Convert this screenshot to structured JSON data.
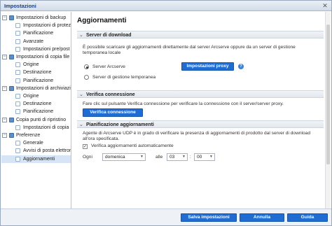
{
  "window": {
    "title": "Impostazioni",
    "close_glyph": "✕"
  },
  "tree": [
    {
      "label": "Impostazioni di backup",
      "level": 0,
      "type": "folder",
      "twisty": "−"
    },
    {
      "label": "Impostazioni di protezio",
      "level": 1,
      "type": "leaf"
    },
    {
      "label": "Pianificazione",
      "level": 1,
      "type": "leaf"
    },
    {
      "label": "Avanzate",
      "level": 1,
      "type": "leaf"
    },
    {
      "label": "Impostazioni pre/post b",
      "level": 1,
      "type": "leaf"
    },
    {
      "label": "Impostazioni di copia file",
      "level": 0,
      "type": "folder",
      "twisty": "−"
    },
    {
      "label": "Origine",
      "level": 1,
      "type": "leaf"
    },
    {
      "label": "Destinazione",
      "level": 1,
      "type": "leaf"
    },
    {
      "label": "Pianificazione",
      "level": 1,
      "type": "leaf"
    },
    {
      "label": "Impostazioni di archiviazior",
      "level": 0,
      "type": "folder",
      "twisty": "−"
    },
    {
      "label": "Origine",
      "level": 1,
      "type": "leaf"
    },
    {
      "label": "Destinazione",
      "level": 1,
      "type": "leaf"
    },
    {
      "label": "Pianificazione",
      "level": 1,
      "type": "leaf"
    },
    {
      "label": "Copia punti di ripristino",
      "level": 0,
      "type": "folder",
      "twisty": "−"
    },
    {
      "label": "Impostazioni di copia",
      "level": 1,
      "type": "leaf"
    },
    {
      "label": "Preferenze",
      "level": 0,
      "type": "folder",
      "twisty": "−"
    },
    {
      "label": "Generale",
      "level": 1,
      "type": "leaf"
    },
    {
      "label": "Avvisi di posta elettroni",
      "level": 1,
      "type": "leaf"
    },
    {
      "label": "Aggiornamenti",
      "level": 1,
      "type": "leaf",
      "selected": true
    }
  ],
  "main": {
    "title": "Aggiornamenti",
    "server": {
      "section_title": "Server di download",
      "description": "È possibile scaricare gli aggiornamenti direttamente dal server Arcserve oppure da un server di gestione temporanea locale",
      "option_arcserve": "Server Arcserve",
      "option_staging": "Server di gestione temporanea",
      "proxy_button": "Impostazioni proxy",
      "help_glyph": "?"
    },
    "verify": {
      "section_title": "Verifica connessione",
      "description": "Fare clic sul pulsante Verifica connessione per verificare la connessione con il server/server proxy.",
      "button": "Verifica connessione"
    },
    "schedule": {
      "section_title": "Pianificazione aggiornamenti",
      "description": "Agente di Arcserve UDP è in grado di verificare la presenza di aggiornamenti di prodotto dal server di download all'ora specificata.",
      "auto_check_label": "Verifica aggiornamenti automaticamente",
      "auto_check_glyph": "✓",
      "every_label": "Ogni",
      "day_value": "domenica",
      "at_label": "alle",
      "hour_value": "03",
      "time_sep": ":",
      "minute_value": "00"
    }
  },
  "footer": {
    "save": "Salva impostazioni",
    "cancel": "Annulla",
    "help": "Guida"
  }
}
